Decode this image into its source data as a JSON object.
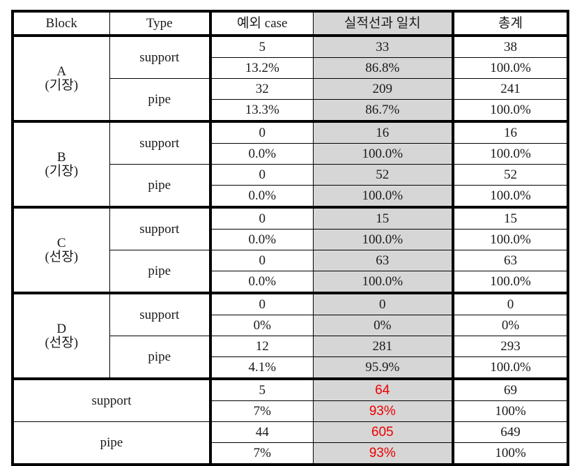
{
  "table": {
    "columns": [
      {
        "key": "block",
        "label": "Block"
      },
      {
        "key": "type",
        "label": "Type"
      },
      {
        "key": "except",
        "label": "예외 case"
      },
      {
        "key": "match",
        "label": "실적선과 일치"
      },
      {
        "key": "total",
        "label": "총계"
      }
    ],
    "shaded_column_key": "match",
    "shaded_column_color": "#d6d6d6",
    "emphasis_color": "#ee0000",
    "blocks": [
      {
        "id": "A",
        "sub": "(기장)",
        "rows": [
          {
            "type": "support",
            "count": {
              "except": "5",
              "match": "33",
              "total": "38"
            },
            "percent": {
              "except": "13.2%",
              "match": "86.8%",
              "total": "100.0%"
            }
          },
          {
            "type": "pipe",
            "count": {
              "except": "32",
              "match": "209",
              "total": "241"
            },
            "percent": {
              "except": "13.3%",
              "match": "86.7%",
              "total": "100.0%"
            }
          }
        ]
      },
      {
        "id": "B",
        "sub": "(기장)",
        "rows": [
          {
            "type": "support",
            "count": {
              "except": "0",
              "match": "16",
              "total": "16"
            },
            "percent": {
              "except": "0.0%",
              "match": "100.0%",
              "total": "100.0%"
            }
          },
          {
            "type": "pipe",
            "count": {
              "except": "0",
              "match": "52",
              "total": "52"
            },
            "percent": {
              "except": "0.0%",
              "match": "100.0%",
              "total": "100.0%"
            }
          }
        ]
      },
      {
        "id": "C",
        "sub": "(선장)",
        "rows": [
          {
            "type": "support",
            "count": {
              "except": "0",
              "match": "15",
              "total": "15"
            },
            "percent": {
              "except": "0.0%",
              "match": "100.0%",
              "total": "100.0%"
            }
          },
          {
            "type": "pipe",
            "count": {
              "except": "0",
              "match": "63",
              "total": "63"
            },
            "percent": {
              "except": "0.0%",
              "match": "100.0%",
              "total": "100.0%"
            }
          }
        ]
      },
      {
        "id": "D",
        "sub": "(선장)",
        "rows": [
          {
            "type": "support",
            "count": {
              "except": "0",
              "match": "0",
              "total": "0"
            },
            "percent": {
              "except": "0%",
              "match": "0%",
              "total": "0%"
            }
          },
          {
            "type": "pipe",
            "count": {
              "except": "12",
              "match": "281",
              "total": "293"
            },
            "percent": {
              "except": "4.1%",
              "match": "95.9%",
              "total": "100.0%"
            }
          }
        ]
      }
    ],
    "summary": [
      {
        "label": "support",
        "count": {
          "except": "5",
          "match": "64",
          "total": "69",
          "match_emphasis": true
        },
        "percent": {
          "except": "7%",
          "match": "93%",
          "total": "100%",
          "match_emphasis": true
        }
      },
      {
        "label": "pipe",
        "count": {
          "except": "44",
          "match": "605",
          "total": "649",
          "match_emphasis": true
        },
        "percent": {
          "except": "7%",
          "match": "93%",
          "total": "100%",
          "match_emphasis": true
        }
      }
    ]
  },
  "chart_data": {
    "type": "table",
    "title": "",
    "columns": [
      "Block",
      "Type",
      "예외 case",
      "실적선과 일치",
      "총계"
    ],
    "rows": [
      [
        "A (기장)",
        "support",
        "5",
        "33",
        "38"
      ],
      [
        "A (기장)",
        "support",
        "13.2%",
        "86.8%",
        "100.0%"
      ],
      [
        "A (기장)",
        "pipe",
        "32",
        "209",
        "241"
      ],
      [
        "A (기장)",
        "pipe",
        "13.3%",
        "86.7%",
        "100.0%"
      ],
      [
        "B (기장)",
        "support",
        "0",
        "16",
        "16"
      ],
      [
        "B (기장)",
        "support",
        "0.0%",
        "100.0%",
        "100.0%"
      ],
      [
        "B (기장)",
        "pipe",
        "0",
        "52",
        "52"
      ],
      [
        "B (기장)",
        "pipe",
        "0.0%",
        "100.0%",
        "100.0%"
      ],
      [
        "C (선장)",
        "support",
        "0",
        "15",
        "15"
      ],
      [
        "C (선장)",
        "support",
        "0.0%",
        "100.0%",
        "100.0%"
      ],
      [
        "C (선장)",
        "pipe",
        "0",
        "63",
        "63"
      ],
      [
        "C (선장)",
        "pipe",
        "0.0%",
        "100.0%",
        "100.0%"
      ],
      [
        "D (선장)",
        "support",
        "0",
        "0",
        "0"
      ],
      [
        "D (선장)",
        "support",
        "0%",
        "0%",
        "0%"
      ],
      [
        "D (선장)",
        "pipe",
        "12",
        "281",
        "293"
      ],
      [
        "D (선장)",
        "pipe",
        "4.1%",
        "95.9%",
        "100.0%"
      ],
      [
        "support",
        "support",
        "5",
        "64",
        "69"
      ],
      [
        "support",
        "support",
        "7%",
        "93%",
        "100%"
      ],
      [
        "pipe",
        "pipe",
        "44",
        "605",
        "649"
      ],
      [
        "pipe",
        "pipe",
        "7%",
        "93%",
        "100%"
      ]
    ]
  }
}
